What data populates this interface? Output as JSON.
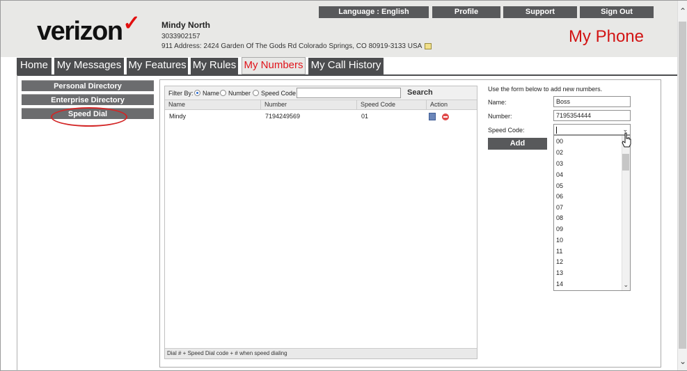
{
  "brand": {
    "logo_text": "verizon",
    "logo_mark": "✓",
    "page_title": "My Phone"
  },
  "user": {
    "name": "Mindy North",
    "phone": "3033902157",
    "address": "911 Address: 2424 Garden Of The Gods Rd Colorado Springs, CO 80919-3133 USA"
  },
  "topnav": {
    "language": "Language : English",
    "profile": "Profile",
    "support": "Support",
    "signout": "Sign Out"
  },
  "tabs": [
    "Home",
    "My Messages",
    "My Features",
    "My Rules",
    "My Numbers",
    "My Call History"
  ],
  "active_tab": "My Numbers",
  "sidebar": {
    "items": [
      "Personal Directory",
      "Enterprise Directory",
      "Speed Dial"
    ],
    "highlighted": "Speed Dial"
  },
  "grid": {
    "filter_label": "Filter By:",
    "filter_options": [
      "Name",
      "Number",
      "Speed Code"
    ],
    "filter_selected": "Name",
    "search_label": "Search",
    "columns": [
      "Name",
      "Number",
      "Speed Code",
      "Action"
    ],
    "rows": [
      {
        "name": "Mindy",
        "number": "7194249569",
        "speed_code": "01"
      }
    ],
    "footer": "Dial # + Speed Dial code + # when speed dialing"
  },
  "form": {
    "intro": "Use the form below to add new numbers.",
    "name_label": "Name:",
    "name_value": "Boss",
    "number_label": "Number:",
    "number_value": "7195354444",
    "speed_code_label": "Speed Code:",
    "speed_code_value": "",
    "add_label": "Add",
    "speed_code_options": [
      "00",
      "02",
      "03",
      "04",
      "05",
      "06",
      "07",
      "08",
      "09",
      "10",
      "11",
      "12",
      "13",
      "14"
    ]
  },
  "colors": {
    "brand_red": "#d21414",
    "nav_dark": "#58595b",
    "header_bg": "#e8e8e6"
  }
}
